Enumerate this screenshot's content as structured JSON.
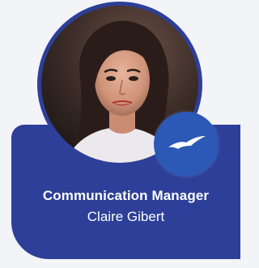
{
  "profile": {
    "job_title": "Communication Manager",
    "name": "Claire Gibert",
    "badge_icon": "seagull-icon"
  },
  "colors": {
    "background": "#f3f4f7",
    "card": "#2d3f98",
    "badge": "#2c58b6",
    "text": "#ffffff"
  }
}
